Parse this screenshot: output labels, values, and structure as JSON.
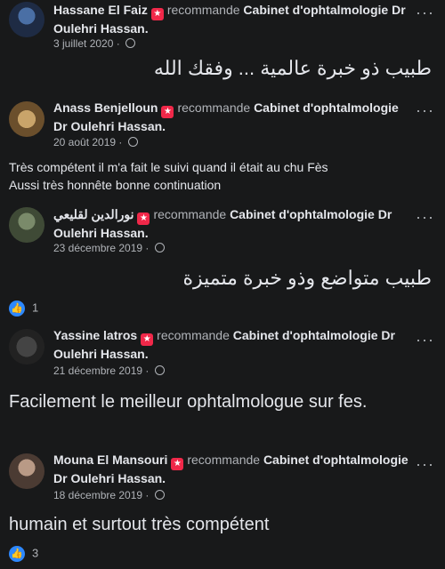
{
  "reviews": [
    {
      "name": "Hassane El Faiz",
      "verb": "recommande",
      "page": "Cabinet d'ophtalmologie Dr Oulehri Hassan.",
      "date": "3 juillet 2020",
      "text": "طبيب ذو خبرة عالمية ... وفقك الله"
    },
    {
      "name": "Anass Benjelloun",
      "verb": "recommande",
      "page": "Cabinet d'ophtalmologie Dr Oulehri Hassan.",
      "date": "20 août 2019",
      "text_line1": "Très compétent il m'a fait le suivi quand il était au chu Fès",
      "text_line2": "Aussi très honnête bonne continuation"
    },
    {
      "name": "نورالدين لقليعي",
      "verb": "recommande",
      "page": "Cabinet d'ophtalmologie Dr Oulehri Hassan.",
      "date": "23 décembre 2019",
      "text": "طبيب متواضع وذو خبرة متميزة",
      "likes": "1"
    },
    {
      "name": "Yassine latros",
      "verb": "recommande",
      "page": "Cabinet d'ophtalmologie Dr Oulehri Hassan.",
      "date": "21 décembre 2019",
      "text": "Facilement le meilleur ophtalmologue sur fes."
    },
    {
      "name": "Mouna El Mansouri",
      "verb": "recommande",
      "page": "Cabinet d'ophtalmologie Dr Oulehri Hassan.",
      "date": "18 décembre 2019",
      "text": "humain et surtout très compétent",
      "likes": "3"
    }
  ],
  "icons": {
    "more": "more-options-icon",
    "recommend": "recommend-badge-icon",
    "privacy": "public-globe-icon",
    "like": "like-thumb-icon"
  }
}
